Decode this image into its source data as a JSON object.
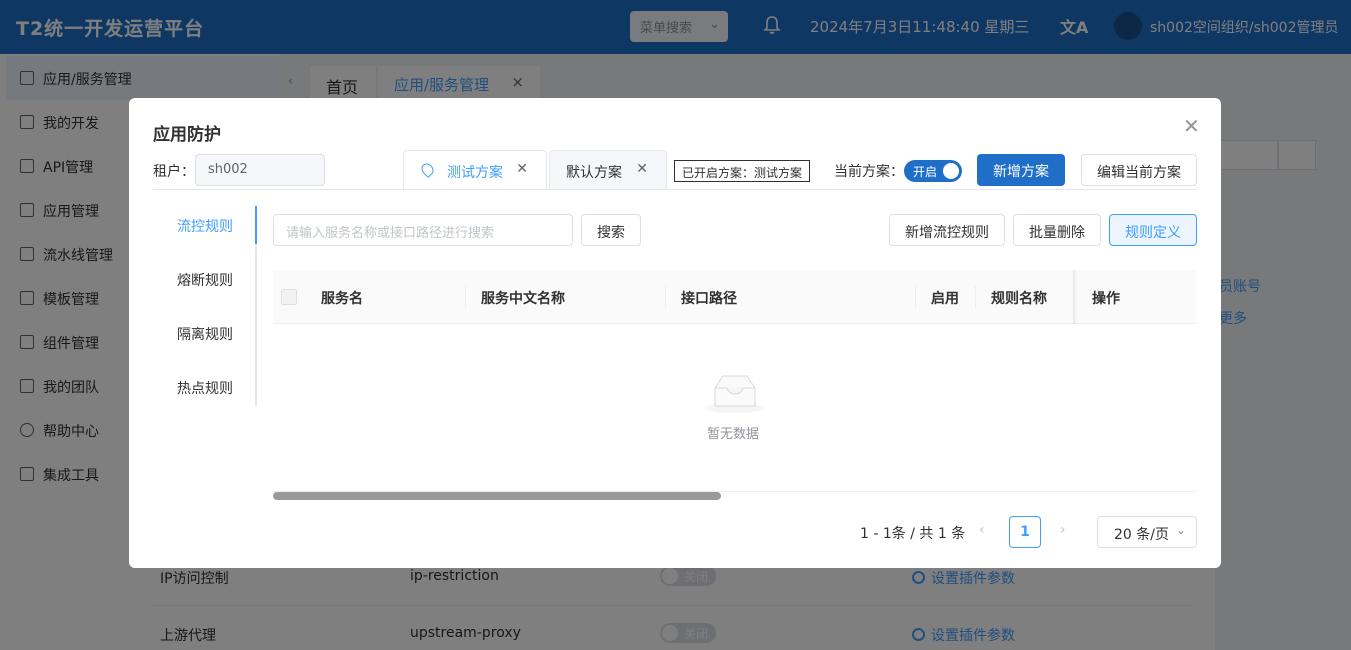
{
  "header": {
    "brand": "T2统一开发运营平台",
    "menu_search_placeholder": "菜单搜索",
    "datetime": "2024年7月3日11:48:40 星期三",
    "user": "sh002空间组织/sh002管理员"
  },
  "sidebar": {
    "items": [
      {
        "label": "应用/服务管理"
      },
      {
        "label": "我的开发"
      },
      {
        "label": "API管理"
      },
      {
        "label": "应用管理"
      },
      {
        "label": "流水线管理"
      },
      {
        "label": "模板管理"
      },
      {
        "label": "组件管理"
      },
      {
        "label": "我的团队"
      },
      {
        "label": "帮助中心"
      },
      {
        "label": "集成工具"
      }
    ]
  },
  "page_tabs": {
    "home": "首页",
    "current": "应用/服务管理"
  },
  "background": {
    "link1": "员账号",
    "link2": "更多",
    "rows": [
      {
        "name": "IP访问控制",
        "code": "ip-restriction",
        "switch": "关闭",
        "action": "设置插件参数"
      },
      {
        "name": "上游代理",
        "code": "upstream-proxy",
        "switch": "关闭",
        "action": "设置插件参数"
      }
    ]
  },
  "dialog": {
    "title": "应用防护",
    "tenant_label": "租户：",
    "tenant_value": "sh002",
    "plan_tabs": [
      {
        "label": "测试方案"
      },
      {
        "label": "默认方案"
      }
    ],
    "enabled_plan": "已开启方案：测试方案",
    "current_plan_label": "当前方案：",
    "toggle_label": "开启",
    "add_plan_btn": "新增方案",
    "edit_plan_btn": "编辑当前方案",
    "rule_tabs": [
      {
        "label": "流控规则"
      },
      {
        "label": "熔断规则"
      },
      {
        "label": "隔离规则"
      },
      {
        "label": "热点规则"
      }
    ],
    "search_placeholder": "请输入服务名称或接口路径进行搜索",
    "search_btn": "搜索",
    "add_flow_btn": "新增流控规则",
    "batch_delete_btn": "批量删除",
    "rule_def_btn": "规则定义",
    "table_headers": [
      "服务名",
      "服务中文名称",
      "接口路径",
      "启用",
      "规则名称",
      "操作"
    ],
    "empty_text": "暂无数据",
    "pagination": {
      "total": "1 - 1条 / 共 1 条",
      "current_page": "1",
      "page_size": "20 条/页"
    }
  },
  "colors": {
    "primary": "#1f6fc9",
    "accent": "#409eff"
  }
}
